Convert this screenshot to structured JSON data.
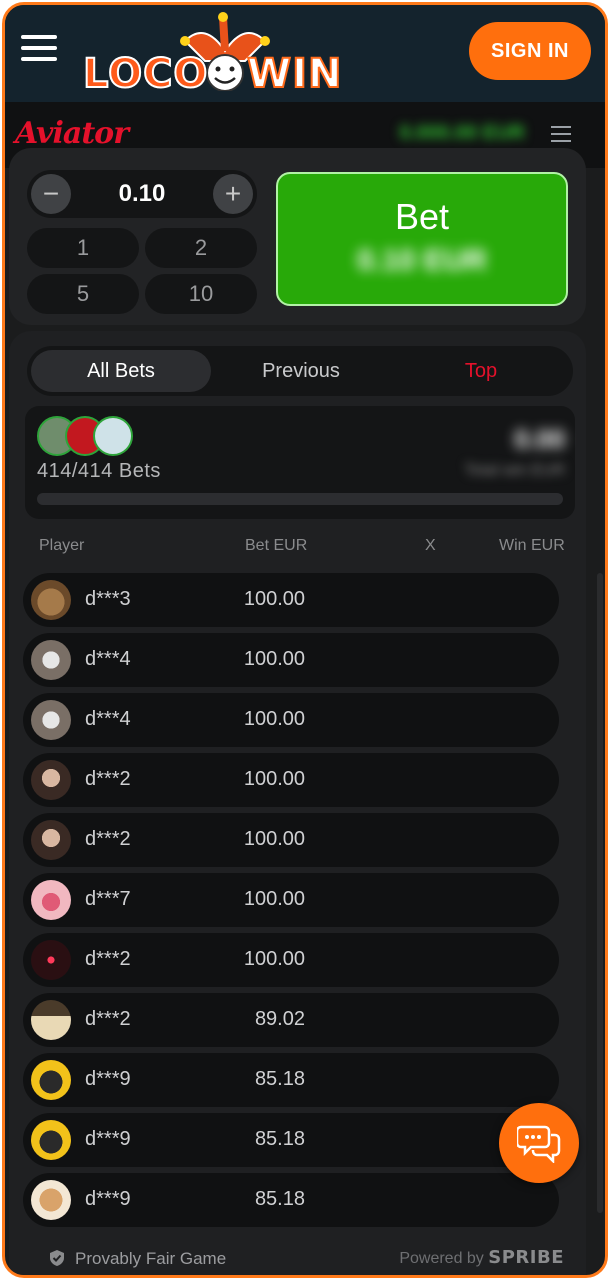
{
  "header": {
    "menu_icon": "hamburger-icon",
    "logo_left": "LOCO",
    "logo_right": "WIN",
    "signin_label": "SIGN IN",
    "accent": "#ff6f0d",
    "background": "#14232d"
  },
  "game": {
    "name": "Aviator",
    "menu_icon": "menu-lines-icon",
    "brand_color": "#e5112b"
  },
  "bet_panel": {
    "amount": "0.10",
    "minus": "−",
    "plus": "+",
    "quick_amounts": [
      "1",
      "2",
      "5",
      "10"
    ],
    "bet_label": "Bet",
    "bet_color": "#28a909"
  },
  "bets": {
    "tabs": [
      "All Bets",
      "Previous",
      "Top"
    ],
    "active_tab": "All Bets",
    "count": "414/414",
    "count_suffix": "Bets",
    "columns": {
      "player": "Player",
      "bet": "Bet EUR",
      "x": "X",
      "win": "Win EUR"
    },
    "rows": [
      {
        "player": "d***3",
        "bet": "100.00",
        "avatar": "lion"
      },
      {
        "player": "d***4",
        "bet": "100.00",
        "avatar": "bird"
      },
      {
        "player": "d***4",
        "bet": "100.00",
        "avatar": "bird"
      },
      {
        "player": "d***2",
        "bet": "100.00",
        "avatar": "woman"
      },
      {
        "player": "d***2",
        "bet": "100.00",
        "avatar": "woman"
      },
      {
        "player": "d***7",
        "bet": "100.00",
        "avatar": "lips"
      },
      {
        "player": "d***2",
        "bet": "100.00",
        "avatar": "neon-mask"
      },
      {
        "player": "d***2",
        "bet": "89.02",
        "avatar": "hat"
      },
      {
        "player": "d***9",
        "bet": "85.18",
        "avatar": "dog"
      },
      {
        "player": "d***9",
        "bet": "85.18",
        "avatar": "dog"
      },
      {
        "player": "d***9",
        "bet": "85.18",
        "avatar": "puppy"
      }
    ]
  },
  "footer": {
    "fair_label": "Provably Fair Game",
    "powered_label": "Powered by",
    "powered_brand": "SPRIBE"
  },
  "chat": {
    "icon": "chat-bubbles-icon"
  }
}
